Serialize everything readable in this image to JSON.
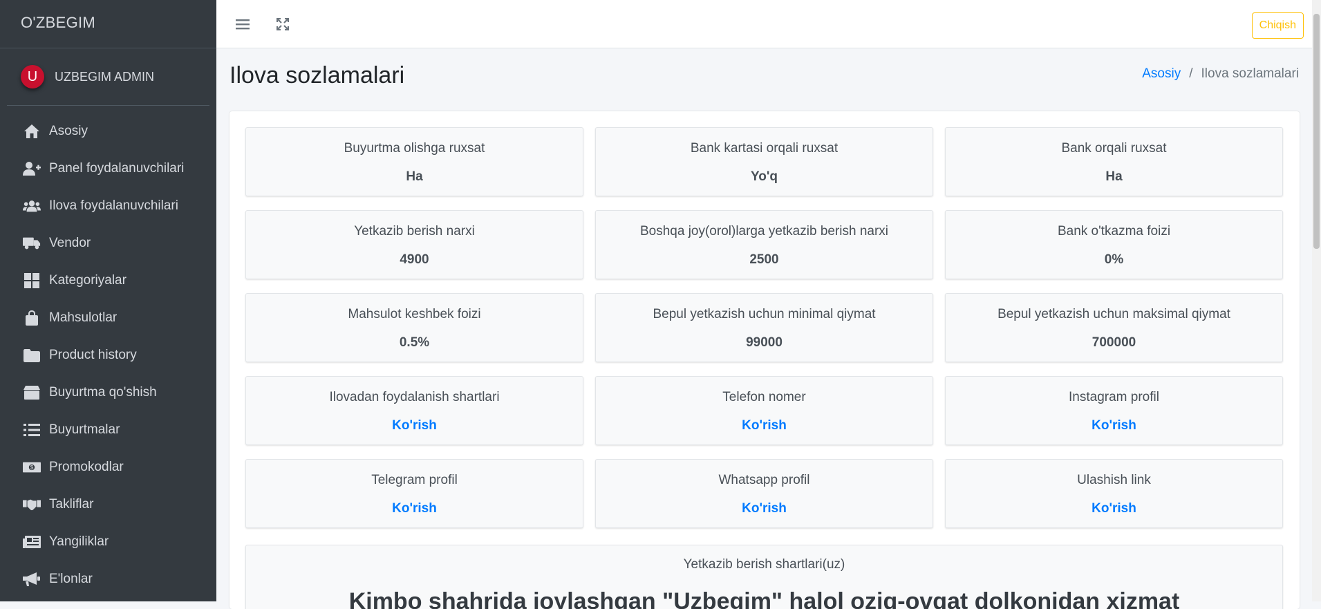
{
  "app": {
    "brand": "O'ZBEGIM"
  },
  "user": {
    "initial": "U",
    "name": "UZBEGIM ADMIN"
  },
  "sidebar": {
    "items": [
      {
        "label": "Asosiy",
        "icon": "home-icon"
      },
      {
        "label": "Panel foydalanuvchilari",
        "icon": "user-plus-icon"
      },
      {
        "label": "Ilova foydalanuvchilari",
        "icon": "users-icon"
      },
      {
        "label": "Vendor",
        "icon": "truck-icon"
      },
      {
        "label": "Kategoriyalar",
        "icon": "grid-icon"
      },
      {
        "label": "Mahsulotlar",
        "icon": "shopping-bag-icon"
      },
      {
        "label": "Product history",
        "icon": "folder-icon"
      },
      {
        "label": "Buyurtma qo'shish",
        "icon": "box-icon"
      },
      {
        "label": "Buyurtmalar",
        "icon": "list-icon"
      },
      {
        "label": "Promokodlar",
        "icon": "money-icon"
      },
      {
        "label": "Takliflar",
        "icon": "handshake-icon"
      },
      {
        "label": "Yangiliklar",
        "icon": "newspaper-icon"
      },
      {
        "label": "E'lonlar",
        "icon": "bullhorn-icon"
      }
    ]
  },
  "topbar": {
    "logout_label": "Chiqish"
  },
  "page": {
    "title": "Ilova sozlamalari",
    "breadcrumb": {
      "home": "Asosiy",
      "current": "Ilova sozlamalari"
    }
  },
  "settings": [
    {
      "label": "Buyurtma olishga ruxsat",
      "value": "Ha",
      "link": false
    },
    {
      "label": "Bank kartasi orqali ruxsat",
      "value": "Yo'q",
      "link": false
    },
    {
      "label": "Bank orqali ruxsat",
      "value": "Ha",
      "link": false
    },
    {
      "label": "Yetkazib berish narxi",
      "value": "4900",
      "link": false
    },
    {
      "label": "Boshqa joy(orol)larga yetkazib berish narxi",
      "value": "2500",
      "link": false
    },
    {
      "label": "Bank o'tkazma foizi",
      "value": "0%",
      "link": false
    },
    {
      "label": "Mahsulot keshbek foizi",
      "value": "0.5%",
      "link": false
    },
    {
      "label": "Bepul yetkazish uchun minimal qiymat",
      "value": "99000",
      "link": false
    },
    {
      "label": "Bepul yetkazish uchun maksimal qiymat",
      "value": "700000",
      "link": false
    },
    {
      "label": "Ilovadan foydalanish shartlari",
      "value": "Ko'rish",
      "link": true
    },
    {
      "label": "Telefon nomer",
      "value": "Ko'rish",
      "link": true
    },
    {
      "label": "Instagram profil",
      "value": "Ko'rish",
      "link": true
    },
    {
      "label": "Telegram profil",
      "value": "Ko'rish",
      "link": true
    },
    {
      "label": "Whatsapp profil",
      "value": "Ko'rish",
      "link": true
    },
    {
      "label": "Ulashish link",
      "value": "Ko'rish",
      "link": true
    }
  ],
  "delivery_terms": {
    "label": "Yetkazib berish shartlari(uz)",
    "text": "Kimbo shahrida joylashgan \"Uzbegim\" halol oziq-ovqat dolkonidan xizmat"
  },
  "colors": {
    "sidebar_bg": "#343a40",
    "accent": "#007bff",
    "logout": "#ffc107",
    "avatar": "#c8102e"
  }
}
